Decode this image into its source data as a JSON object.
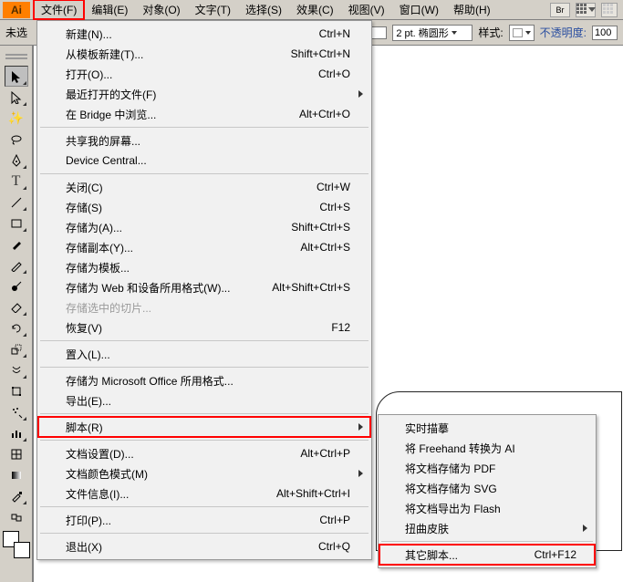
{
  "app": {
    "icon_label": "Ai"
  },
  "menubar": {
    "file": "文件(F)",
    "edit": "编辑(E)",
    "object": "对象(O)",
    "type": "文字(T)",
    "select": "选择(S)",
    "effect": "效果(C)",
    "view": "视图(V)",
    "window": "窗口(W)",
    "help": "帮助(H)",
    "br_label": "Br"
  },
  "options": {
    "doc_label": "未选",
    "stroke_label": "2 pt. 椭圆形",
    "style_label": "样式:",
    "opacity_label": "不透明度:",
    "opacity_value": "100"
  },
  "file_menu": {
    "new": {
      "label": "新建(N)...",
      "shortcut": "Ctrl+N"
    },
    "new_template": {
      "label": "从模板新建(T)...",
      "shortcut": "Shift+Ctrl+N"
    },
    "open": {
      "label": "打开(O)...",
      "shortcut": "Ctrl+O"
    },
    "open_recent": {
      "label": "最近打开的文件(F)"
    },
    "browse_bridge": {
      "label": "在 Bridge 中浏览...",
      "shortcut": "Alt+Ctrl+O"
    },
    "share_screen": {
      "label": "共享我的屏幕..."
    },
    "device_central": {
      "label": "Device Central..."
    },
    "close": {
      "label": "关闭(C)",
      "shortcut": "Ctrl+W"
    },
    "save": {
      "label": "存储(S)",
      "shortcut": "Ctrl+S"
    },
    "save_as": {
      "label": "存储为(A)...",
      "shortcut": "Shift+Ctrl+S"
    },
    "save_copy": {
      "label": "存储副本(Y)...",
      "shortcut": "Alt+Ctrl+S"
    },
    "save_template": {
      "label": "存储为模板..."
    },
    "save_web": {
      "label": "存储为 Web 和设备所用格式(W)...",
      "shortcut": "Alt+Shift+Ctrl+S"
    },
    "save_slices": {
      "label": "存储选中的切片..."
    },
    "revert": {
      "label": "恢复(V)",
      "shortcut": "F12"
    },
    "place": {
      "label": "置入(L)..."
    },
    "save_ms": {
      "label": "存储为 Microsoft Office 所用格式..."
    },
    "export": {
      "label": "导出(E)..."
    },
    "scripts": {
      "label": "脚本(R)"
    },
    "doc_setup": {
      "label": "文档设置(D)...",
      "shortcut": "Alt+Ctrl+P"
    },
    "color_mode": {
      "label": "文档颜色模式(M)"
    },
    "file_info": {
      "label": "文件信息(I)...",
      "shortcut": "Alt+Shift+Ctrl+I"
    },
    "print": {
      "label": "打印(P)...",
      "shortcut": "Ctrl+P"
    },
    "exit": {
      "label": "退出(X)",
      "shortcut": "Ctrl+Q"
    }
  },
  "scripts_submenu": {
    "live_trace": {
      "label": "实时描摹"
    },
    "freehand": {
      "label": "将 Freehand 转换为 AI"
    },
    "save_pdf": {
      "label": "将文档存储为 PDF"
    },
    "save_svg": {
      "label": "将文档存储为 SVG"
    },
    "export_flash": {
      "label": "将文档导出为 Flash"
    },
    "warp": {
      "label": "扭曲皮肤"
    },
    "other": {
      "label": "其它脚本...",
      "shortcut": "Ctrl+F12"
    }
  },
  "tools": {
    "selection": "▲",
    "direct": "△",
    "wand": "✦",
    "lasso": "◯",
    "pen": "✒",
    "type": "T",
    "line": "╲",
    "rect": "▭",
    "brush": "🖌",
    "pencil": "✎",
    "blob": "●",
    "eraser": "⌫",
    "rotate": "↻",
    "scale": "⤢",
    "warp": "≋",
    "free": "⊞",
    "symbol": "☼",
    "graph": "▥",
    "mesh": "▦",
    "gradient": "▤",
    "eyedrop": "✑",
    "blend": "⬚",
    "live": "◧",
    "slice": "✂",
    "hand": "✋",
    "zoom": "🔍"
  }
}
